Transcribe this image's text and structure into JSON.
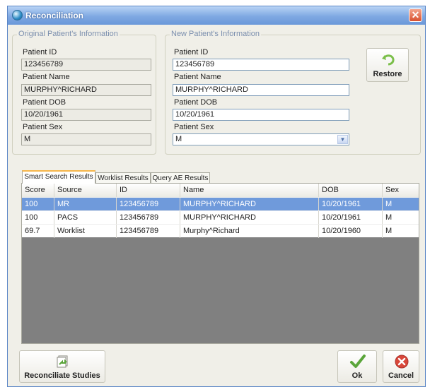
{
  "window": {
    "title": "Reconciliation",
    "close_glyph": "✕"
  },
  "original": {
    "legend": "Original Patient's Information",
    "patient_id_label": "Patient ID",
    "patient_id_value": "123456789",
    "patient_name_label": "Patient Name",
    "patient_name_value": "MURPHY^RICHARD",
    "patient_dob_label": "Patient DOB",
    "patient_dob_value": "10/20/1961",
    "patient_sex_label": "Patient Sex",
    "patient_sex_value": "M"
  },
  "new_patient": {
    "legend": "New Patient's Information",
    "patient_id_label": "Patient ID",
    "patient_id_value": "123456789",
    "patient_name_label": "Patient Name",
    "patient_name_value": "MURPHY^RICHARD",
    "patient_dob_label": "Patient DOB",
    "patient_dob_value": "10/20/1961",
    "patient_sex_label": "Patient Sex",
    "patient_sex_value": "M"
  },
  "restore_button": {
    "label": "Restore",
    "icon": "undo-arrow-icon"
  },
  "tabs": [
    {
      "label": "Smart Search Results",
      "active": true
    },
    {
      "label": "Worklist Results",
      "active": false
    },
    {
      "label": "Query AE Results",
      "active": false
    }
  ],
  "results": {
    "columns": [
      "Score",
      "Source",
      "ID",
      "Name",
      "DOB",
      "Sex"
    ],
    "rows": [
      {
        "score": "100",
        "source": "MR",
        "id": "123456789",
        "name": "MURPHY^RICHARD",
        "dob": "10/20/1961",
        "sex": "M",
        "selected": true
      },
      {
        "score": "100",
        "source": "PACS",
        "id": "123456789",
        "name": "MURPHY^RICHARD",
        "dob": "10/20/1961",
        "sex": "M",
        "selected": false
      },
      {
        "score": "69.7",
        "source": "Worklist",
        "id": "123456789",
        "name": "Murphy^Richard",
        "dob": "10/20/1960",
        "sex": "M",
        "selected": false
      }
    ]
  },
  "buttons": {
    "reconciliate_label": "Reconciliate Studies",
    "ok_label": "Ok",
    "cancel_label": "Cancel"
  },
  "colors": {
    "selection": "#6f9adb",
    "ok_check": "#5aa53a",
    "cancel_circle": "#d9473a",
    "titlebar": "#7fa8e2"
  }
}
